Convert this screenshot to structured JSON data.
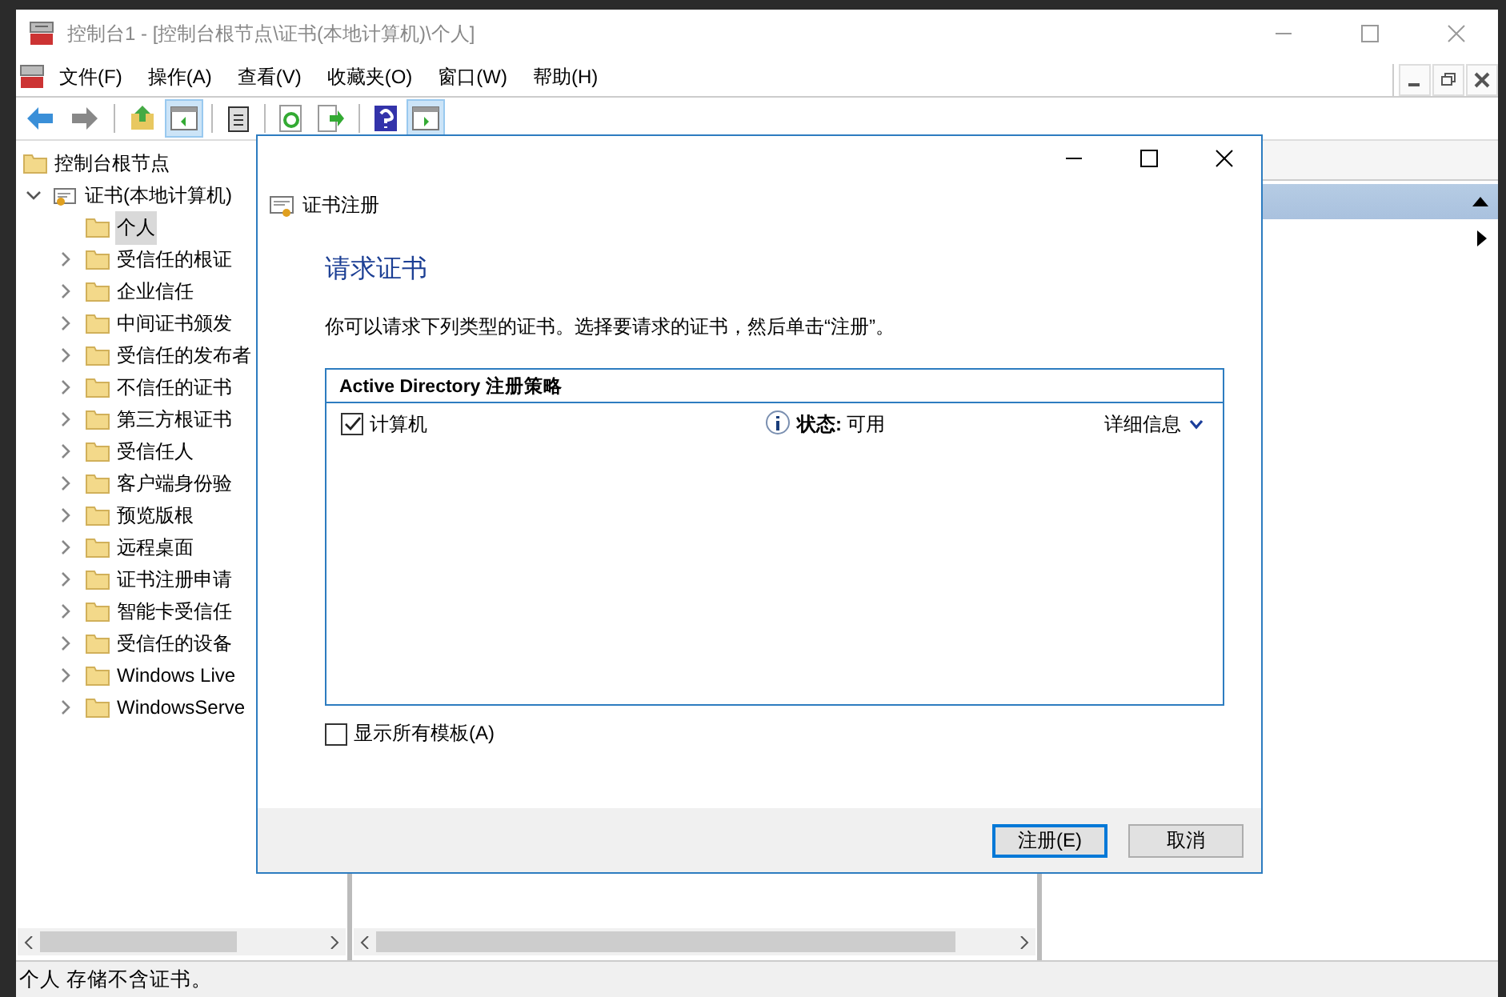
{
  "window": {
    "title": "控制台1 - [控制台根节点\\证书(本地计算机)\\个人]"
  },
  "menu": [
    "文件(F)",
    "操作(A)",
    "查看(V)",
    "收藏夹(O)",
    "窗口(W)",
    "帮助(H)"
  ],
  "toolbar": [
    {
      "kind": "back",
      "selected": false
    },
    {
      "kind": "forward",
      "selected": false
    },
    {
      "kind": "up",
      "selected": false
    },
    {
      "kind": "tree",
      "selected": true
    },
    {
      "kind": "clipboard",
      "selected": false
    },
    {
      "kind": "refresh",
      "selected": false
    },
    {
      "kind": "export",
      "selected": false
    },
    {
      "kind": "help",
      "selected": false
    },
    {
      "kind": "pane",
      "selected": true
    }
  ],
  "tree": [
    {
      "label": "控制台根节点",
      "kind": "folder",
      "selected": false,
      "children": [
        {
          "label": "证书(本地计算机)",
          "kind": "cert",
          "expanded": true,
          "selected": false,
          "children": [
            {
              "label": "个人",
              "kind": "folder",
              "selected": true
            },
            {
              "label": "受信任的根证",
              "kind": "folder",
              "expanded": false,
              "selected": false
            },
            {
              "label": "企业信任",
              "kind": "folder",
              "expanded": false,
              "selected": false
            },
            {
              "label": "中间证书颁发",
              "kind": "folder",
              "expanded": false,
              "selected": false
            },
            {
              "label": "受信任的发布者",
              "kind": "folder",
              "expanded": false,
              "selected": false
            },
            {
              "label": "不信任的证书",
              "kind": "folder",
              "expanded": false,
              "selected": false
            },
            {
              "label": "第三方根证书",
              "kind": "folder",
              "expanded": false,
              "selected": false
            },
            {
              "label": "受信任人",
              "kind": "folder",
              "expanded": false,
              "selected": false
            },
            {
              "label": "客户端身份验",
              "kind": "folder",
              "expanded": false,
              "selected": false
            },
            {
              "label": "预览版根",
              "kind": "folder",
              "expanded": false,
              "selected": false
            },
            {
              "label": "远程桌面",
              "kind": "folder",
              "expanded": false,
              "selected": false
            },
            {
              "label": "证书注册申请",
              "kind": "folder",
              "expanded": false,
              "selected": false
            },
            {
              "label": "智能卡受信任",
              "kind": "folder",
              "expanded": false,
              "selected": false
            },
            {
              "label": "受信任的设备",
              "kind": "folder",
              "expanded": false,
              "selected": false
            },
            {
              "label": "Windows Live",
              "kind": "folder",
              "expanded": false,
              "selected": false
            },
            {
              "label": "WindowsServe",
              "kind": "folder",
              "expanded": false,
              "selected": false
            }
          ]
        }
      ]
    }
  ],
  "dialog": {
    "title": "证书注册",
    "heading": "请求证书",
    "description": "你可以请求下列类型的证书。选择要请求的证书，然后单击“注册”。",
    "policy": {
      "title": "Active Directory 注册策略",
      "items": [
        {
          "label": "计算机",
          "checked": true,
          "status_label": "状态:",
          "status_value": "可用",
          "details": "详细信息"
        }
      ]
    },
    "show_all": {
      "label": "显示所有模板(A)",
      "checked": false
    },
    "buttons": [
      {
        "label": "注册(E)",
        "default": true
      },
      {
        "label": "取消",
        "default": false
      }
    ]
  },
  "status_bar": "个人 存储不含证书。"
}
